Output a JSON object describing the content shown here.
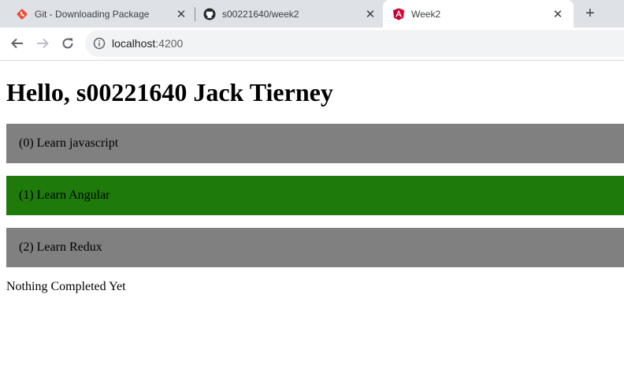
{
  "browser": {
    "tabs": [
      {
        "title": "Git - Downloading Package",
        "icon": "git-icon",
        "active": false
      },
      {
        "title": "s00221640/week2",
        "icon": "github-icon",
        "active": false
      },
      {
        "title": "Week2",
        "icon": "angular-icon",
        "active": true
      }
    ],
    "new_tab_label": "+",
    "close_glyph": "✕",
    "url_host": "localhost",
    "url_port": ":4200"
  },
  "page": {
    "heading": "Hello, s00221640 Jack Tierney",
    "todos": [
      {
        "label": "(0) Learn javascript",
        "color": "#808080"
      },
      {
        "label": "(1) Learn Angular",
        "color": "#1e7b09"
      },
      {
        "label": "(2) Learn Redux",
        "color": "#808080"
      }
    ],
    "status": "Nothing Completed Yet"
  },
  "colors": {
    "tabstrip_bg": "#dee1e6",
    "todo_default": "#808080",
    "todo_highlight": "#1e7b09"
  }
}
